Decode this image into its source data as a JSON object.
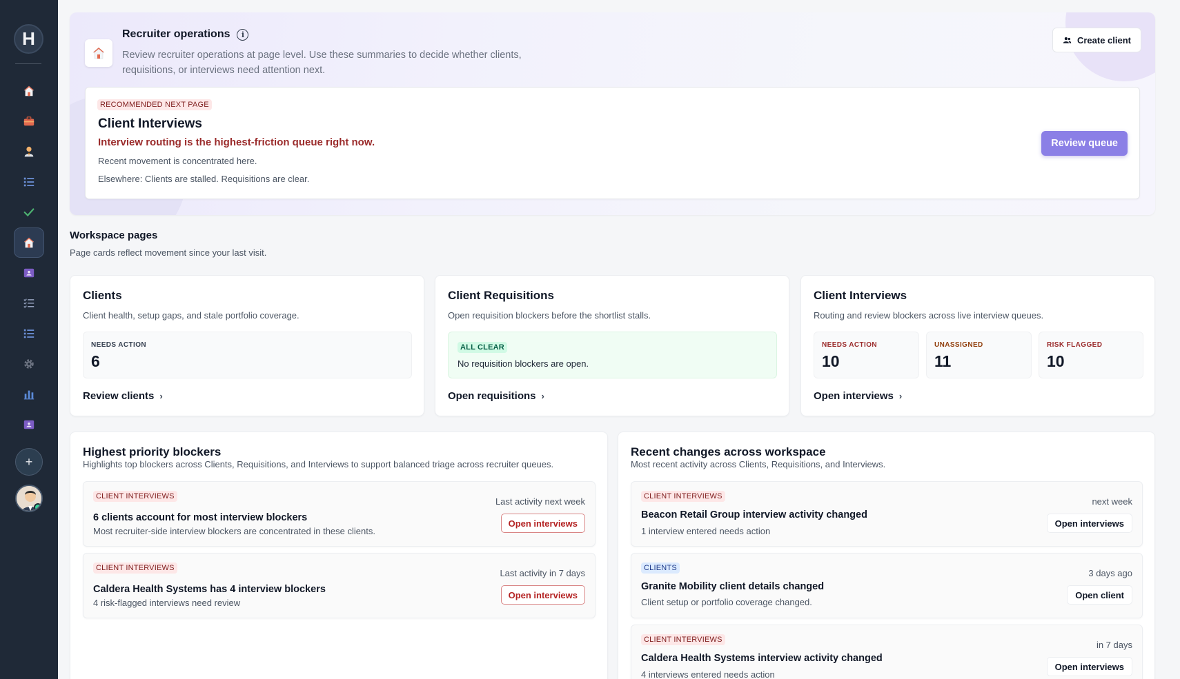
{
  "sidebar": {
    "logo_letter": "H",
    "items": [
      {
        "icon": "home-icon"
      },
      {
        "icon": "briefcase-icon"
      },
      {
        "icon": "user-icon"
      },
      {
        "icon": "list-icon"
      },
      {
        "icon": "check-icon"
      },
      {
        "icon": "home-icon",
        "active": true
      },
      {
        "icon": "id-card-icon"
      },
      {
        "icon": "checklist-icon"
      },
      {
        "icon": "list-icon"
      },
      {
        "icon": "gear-icon"
      },
      {
        "icon": "bar-chart-icon"
      },
      {
        "icon": "id-card-icon"
      }
    ],
    "add_label": "+"
  },
  "hero": {
    "title": "Recruiter operations",
    "description": "Review recruiter operations at page level. Use these summaries to decide whether clients, requisitions, or interviews need attention next.",
    "create_client_label": "Create client",
    "recommendation": {
      "badge": "RECOMMENDED NEXT PAGE",
      "title": "Client Interviews",
      "alert": "Interview routing is the highest-friction queue right now.",
      "line1": "Recent movement is concentrated here.",
      "line2": "Elsewhere: Clients are stalled. Requisitions are clear.",
      "button_label": "Review queue"
    }
  },
  "workspace": {
    "title": "Workspace pages",
    "subtitle": "Page cards reflect movement since your last visit.",
    "cards": [
      {
        "title": "Clients",
        "description": "Client health, setup gaps, and stale portfolio coverage.",
        "metrics": [
          {
            "label": "NEEDS ACTION",
            "value": "6"
          }
        ],
        "link": "Review clients"
      },
      {
        "title": "Client Requisitions",
        "description": "Open requisition blockers before the shortlist stalls.",
        "clear_badge": "ALL CLEAR",
        "clear_text": "No requisition blockers are open.",
        "link": "Open requisitions"
      },
      {
        "title": "Client Interviews",
        "description": "Routing and review blockers across live interview queues.",
        "metrics": [
          {
            "label": "NEEDS ACTION",
            "value": "10"
          },
          {
            "label": "UNASSIGNED",
            "value": "11"
          },
          {
            "label": "RISK FLAGGED",
            "value": "10"
          }
        ],
        "link": "Open interviews"
      }
    ]
  },
  "blockers": {
    "title": "Highest priority blockers",
    "subtitle": "Highlights top blockers across Clients, Requisitions, and Interviews to support balanced triage across recruiter queues.",
    "items": [
      {
        "badge": "CLIENT INTERVIEWS",
        "title": "6 clients account for most interview blockers",
        "description": "Most recruiter-side interview blockers are concentrated in these clients.",
        "meta": "Last activity next week",
        "button": "Open interviews"
      },
      {
        "badge": "CLIENT INTERVIEWS",
        "title": "Caldera Health Systems has 4 interview blockers",
        "description": "4 risk-flagged interviews need review",
        "meta": "Last activity in 7 days",
        "button": "Open interviews"
      }
    ]
  },
  "changes": {
    "title": "Recent changes across workspace",
    "subtitle": "Most recent activity across Clients, Requisitions, and Interviews.",
    "items": [
      {
        "badge": "CLIENT INTERVIEWS",
        "title": "Beacon Retail Group interview activity changed",
        "description": "1 interview entered needs action",
        "meta": "next week",
        "button": "Open interviews"
      },
      {
        "badge": "CLIENTS",
        "title": "Granite Mobility client details changed",
        "description": "Client setup or portfolio coverage changed.",
        "meta": "3 days ago",
        "button": "Open client"
      },
      {
        "badge": "CLIENT INTERVIEWS",
        "title": "Caldera Health Systems interview activity changed",
        "description": "4 interviews entered needs action",
        "meta": "in 7 days",
        "button": "Open interviews"
      }
    ]
  },
  "colors": {
    "sidebar_bg": "#1f2937",
    "accent": "#8b7fe6",
    "alert_red": "#9b2c2c",
    "badge_red_bg": "#fde7e7",
    "badge_blue_bg": "#dbeafe",
    "badge_green_bg": "#d1fae5"
  }
}
